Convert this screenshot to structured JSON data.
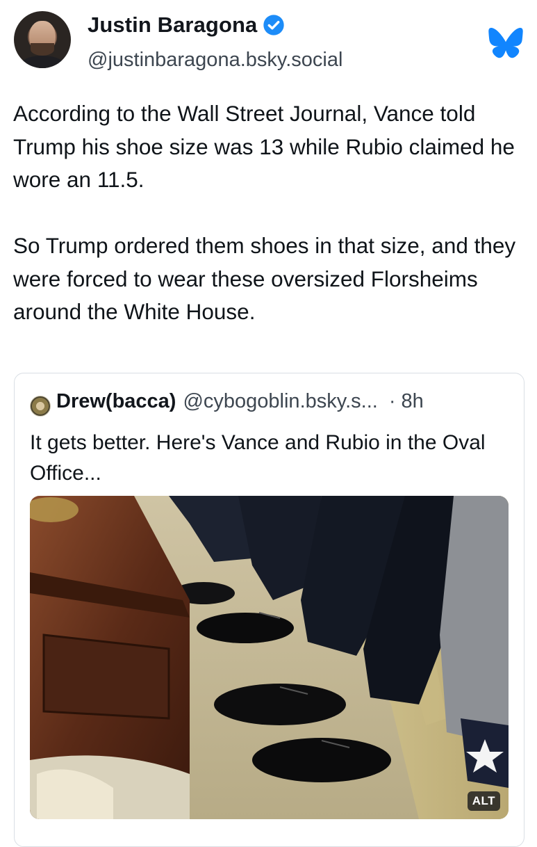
{
  "post": {
    "author_name": "Justin Baragona",
    "author_handle": "@justinbaragona.bsky.social",
    "text": "According to the Wall Street Journal, Vance told Trump his shoe size was 13 while Rubio claimed he wore an 11.5.\n\nSo Trump ordered them shoes in that size, and they were forced to wear these oversized Florsheims around the White House."
  },
  "quote": {
    "author_name": "Drew(bacca)",
    "author_handle": "@cybogoblin.bsky.s...",
    "time": "· 8h",
    "text": "It gets better. Here's Vance and Rubio in the Oval Office...",
    "image_alt_badge": "ALT"
  },
  "icons": {
    "verified": "verified-badge-icon",
    "app_logo": "bluesky-butterfly-icon"
  },
  "colors": {
    "verified_blue": "#1d8cf8",
    "bluesky_blue": "#1185fe",
    "border": "#d9dee4"
  }
}
